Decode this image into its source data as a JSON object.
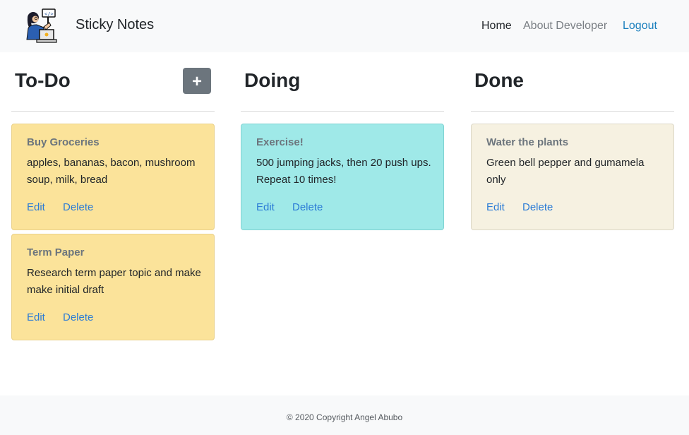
{
  "header": {
    "brand": "Sticky Notes",
    "nav": {
      "home": "Home",
      "about": "About Developer",
      "logout": "Logout"
    }
  },
  "columns": [
    {
      "title": "To-Do",
      "color": "#fbe39a",
      "add_button_symbol": "+",
      "cards": [
        {
          "title": "Buy Groceries",
          "text": "apples, bananas, bacon, mushroom soup, milk, bread",
          "edit": "Edit",
          "delete": "Delete"
        },
        {
          "title": "Term Paper",
          "text": "Research term paper topic and make make initial draft",
          "edit": "Edit",
          "delete": "Delete"
        }
      ]
    },
    {
      "title": "Doing",
      "color": "#9fe9e8",
      "cards": [
        {
          "title": "Exercise!",
          "text": "500 jumping jacks, then 20 push ups. Repeat 10 times!",
          "edit": "Edit",
          "delete": "Delete"
        }
      ]
    },
    {
      "title": "Done",
      "color": "#f6f1e1",
      "cards": [
        {
          "title": "Water the plants",
          "text": "Green bell pepper and gumamela only",
          "edit": "Edit",
          "delete": "Delete"
        }
      ]
    }
  ],
  "footer": {
    "copyright": "© 2020 Copyright Angel Abubo"
  },
  "icons": {
    "logo": "developer-laptop-logo",
    "add": "plus-icon"
  }
}
